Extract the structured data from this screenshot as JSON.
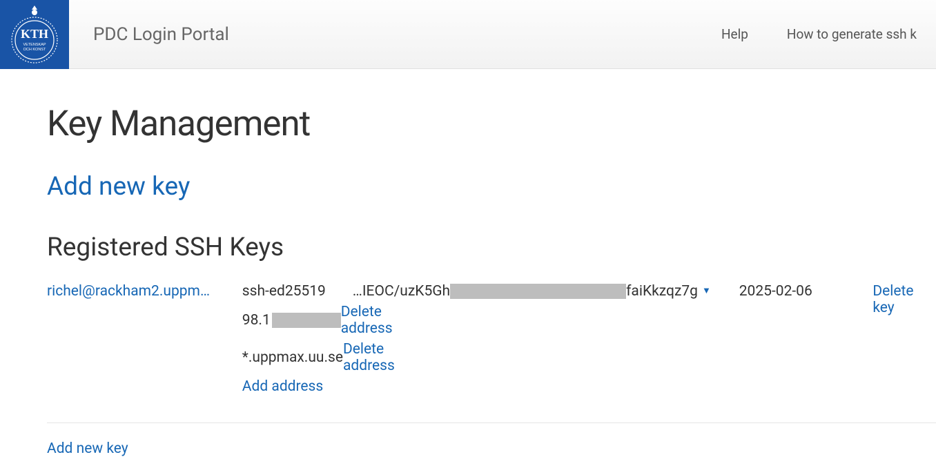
{
  "header": {
    "app_title": "PDC Login Portal",
    "nav": {
      "help": "Help",
      "howto": "How to generate ssh k"
    },
    "logo": {
      "name": "KTH",
      "sub1": "VETENSKAP",
      "sub2": "OCH KONST"
    }
  },
  "page": {
    "title": "Key Management",
    "add_new_key": "Add new key",
    "registered_title": "Registered SSH Keys"
  },
  "key": {
    "user": "richel@rackham2.uppm…",
    "type": "ssh-ed25519",
    "fingerprint_prefix": "…IEOC/uzK5Gh",
    "fingerprint_suffix": "faiKkzqz7g",
    "date": "2025-02-06",
    "delete": "Delete key",
    "addresses": [
      {
        "text": "98.1",
        "delete": "Delete address"
      },
      {
        "text": "*.uppmax.uu.se",
        "delete": "Delete address"
      }
    ],
    "add_address": "Add address"
  },
  "footer": {
    "add_new_key": "Add new key"
  }
}
